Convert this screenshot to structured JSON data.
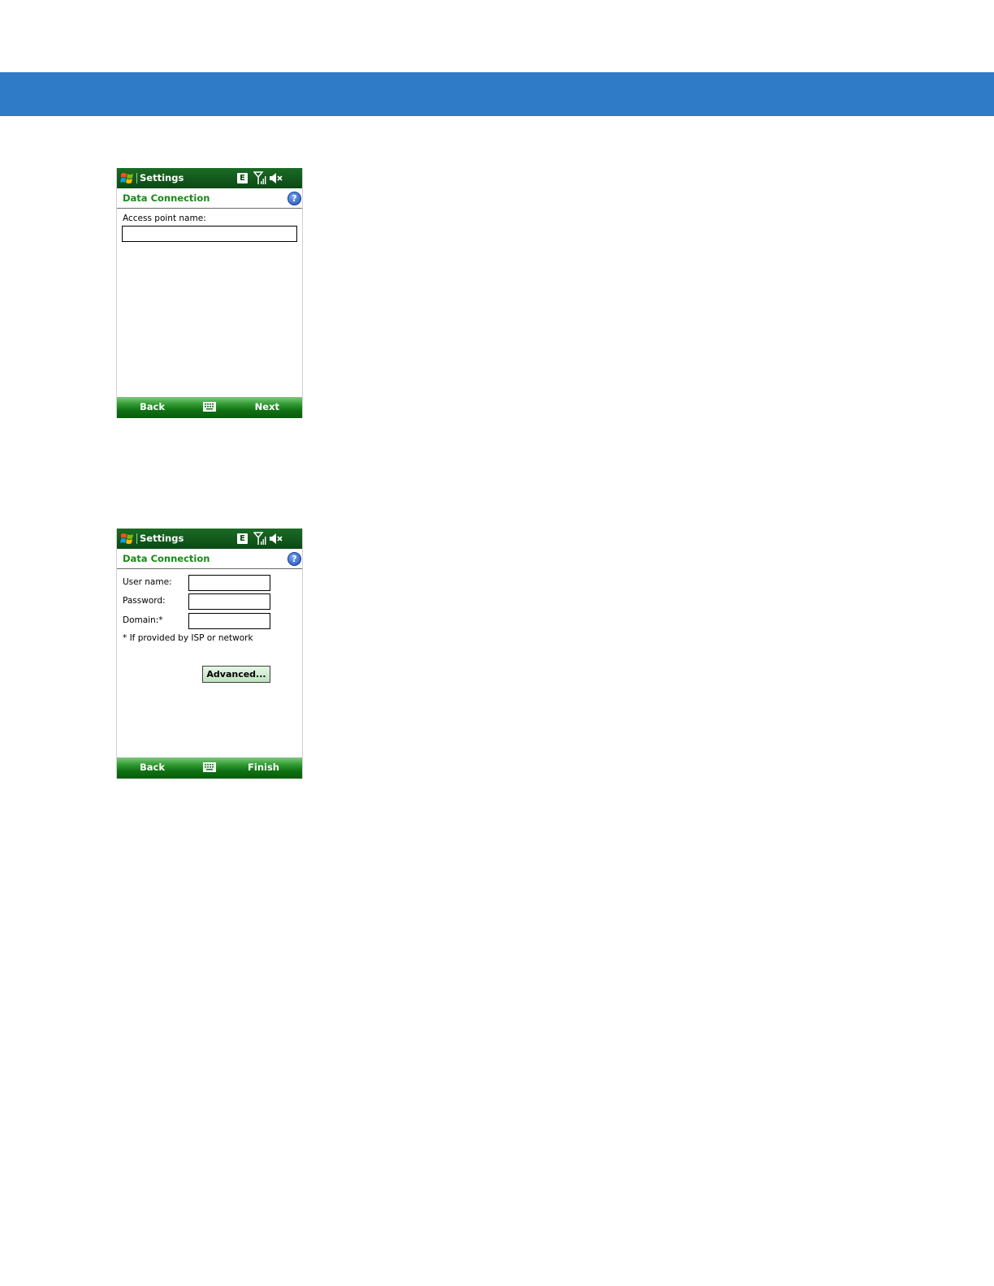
{
  "screens": [
    {
      "title": "Settings",
      "network_badge": "E",
      "icons": [
        "windows-start-icon",
        "signal-icon",
        "volume-muted-icon",
        "help-icon",
        "keyboard-icon"
      ],
      "subheader": "Data Connection",
      "help_glyph": "?",
      "fields": [
        {
          "label": "Access point name:",
          "value": ""
        }
      ],
      "softkeys": {
        "left": "Back",
        "right": "Next"
      }
    },
    {
      "title": "Settings",
      "network_badge": "E",
      "icons": [
        "windows-start-icon",
        "signal-icon",
        "volume-muted-icon",
        "help-icon",
        "keyboard-icon"
      ],
      "subheader": "Data Connection",
      "help_glyph": "?",
      "fields": [
        {
          "label": "User name:",
          "value": ""
        },
        {
          "label": "Password:",
          "value": ""
        },
        {
          "label": "Domain:*",
          "value": ""
        }
      ],
      "note": "* If provided by ISP or network",
      "advanced_button": "Advanced...",
      "softkeys": {
        "left": "Back",
        "right": "Finish"
      }
    }
  ],
  "colors": {
    "page_band": "#2f7bc8",
    "titlebar": "#0b4a14",
    "subheader_text": "#188a18",
    "softbar": "#0f6f12"
  }
}
